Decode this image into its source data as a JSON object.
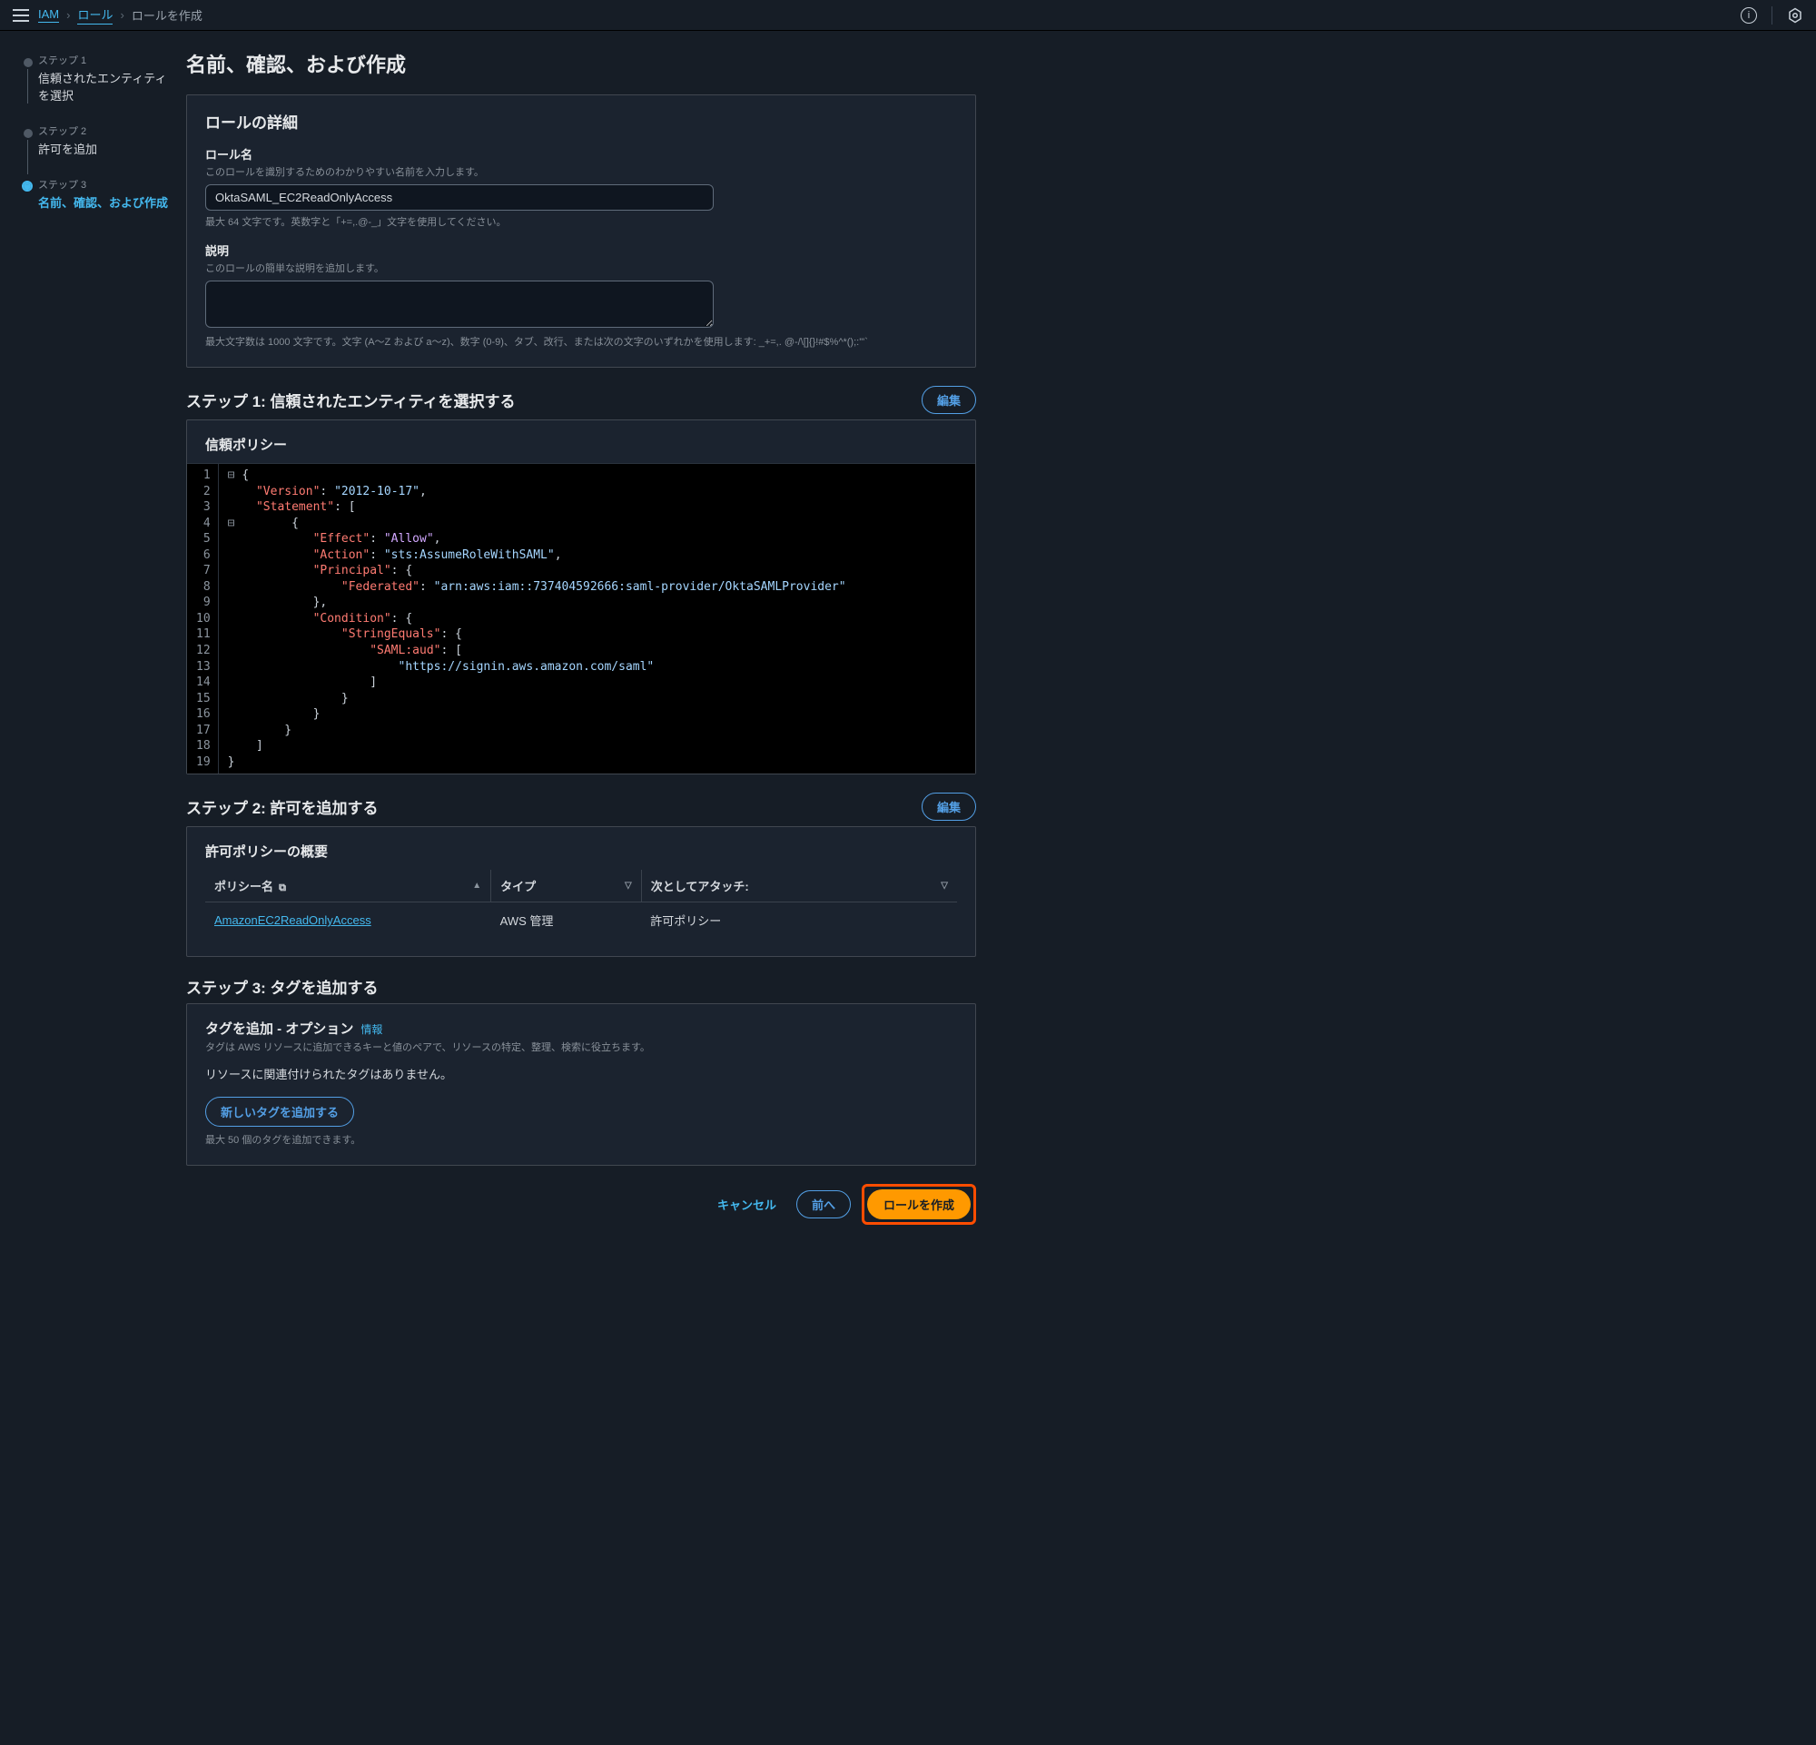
{
  "breadcrumb": {
    "iam": "IAM",
    "roles": "ロール",
    "current": "ロールを作成"
  },
  "steps": [
    {
      "num": "ステップ 1",
      "title": "信頼されたエンティティを選択"
    },
    {
      "num": "ステップ 2",
      "title": "許可を追加"
    },
    {
      "num": "ステップ 3",
      "title": "名前、確認、および作成"
    }
  ],
  "page_title": "名前、確認、および作成",
  "role_details": {
    "panel_title": "ロールの詳細",
    "name_label": "ロール名",
    "name_hint": "このロールを識別するためのわかりやすい名前を入力します。",
    "name_value": "OktaSAML_EC2ReadOnlyAccess",
    "name_help": "最大 64 文字です。英数字と「+=,.@-_」文字を使用してください。",
    "desc_label": "説明",
    "desc_hint": "このロールの簡単な説明を追加します。",
    "desc_value": "",
    "desc_help": "最大文字数は 1000 文字です。文字 (A～Z および a～z)、数字 (0-9)、タブ、改行、または次の文字のいずれかを使用します: _+=,. @-/\\[]{}!#$%^*();:'\"`"
  },
  "step1": {
    "heading": "ステップ 1: 信頼されたエンティティを選択する",
    "edit": "編集",
    "subtitle": "信頼ポリシー",
    "code_lines": [
      "{",
      "    \"Version\": \"2012-10-17\",",
      "    \"Statement\": [",
      "        {",
      "            \"Effect\": \"Allow\",",
      "            \"Action\": \"sts:AssumeRoleWithSAML\",",
      "            \"Principal\": {",
      "                \"Federated\": \"arn:aws:iam::737404592666:saml-provider/OktaSAMLProvider\"",
      "            },",
      "            \"Condition\": {",
      "                \"StringEquals\": {",
      "                    \"SAML:aud\": [",
      "                        \"https://signin.aws.amazon.com/saml\"",
      "                    ]",
      "                }",
      "            }",
      "        }",
      "    ]",
      "}"
    ]
  },
  "step2": {
    "heading": "ステップ 2: 許可を追加する",
    "edit": "編集",
    "subtitle": "許可ポリシーの概要",
    "cols": {
      "name": "ポリシー名",
      "type": "タイプ",
      "attach": "次としてアタッチ:"
    },
    "row": {
      "name": "AmazonEC2ReadOnlyAccess",
      "type": "AWS 管理",
      "attach": "許可ポリシー"
    }
  },
  "step3": {
    "heading": "ステップ 3: タグを追加する",
    "tag_title": "タグを追加 - オプション",
    "info": "情報",
    "tag_hint": "タグは AWS リソースに追加できるキーと値のペアで、リソースの特定、整理、検索に役立ちます。",
    "no_tags": "リソースに関連付けられたタグはありません。",
    "add_btn": "新しいタグを追加する",
    "limit": "最大 50 個のタグを追加できます。"
  },
  "footer": {
    "cancel": "キャンセル",
    "prev": "前へ",
    "create": "ロールを作成"
  }
}
